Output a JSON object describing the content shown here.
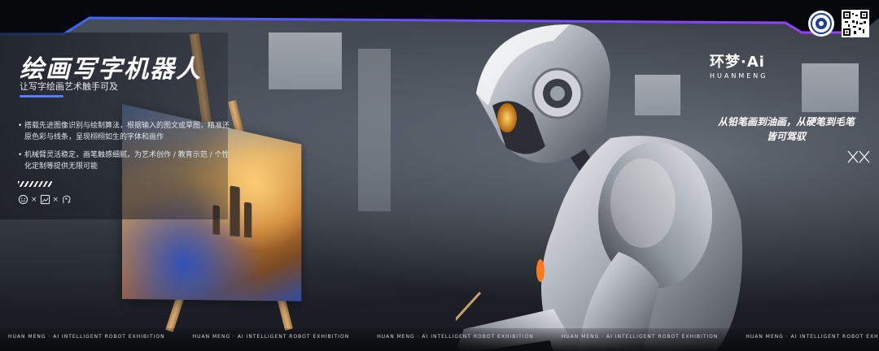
{
  "title": "绘画写字机器人",
  "subtitle": "让写字绘画艺术触手可及",
  "bullets": [
    "搭载先进图像识别与绘制算法，根据输入的图文或草图，精准还原色彩与线条，呈现栩栩如生的字体和画作",
    "机械臂灵活稳定，画笔触感细腻，为艺术创作 / 教育示范 / 个性化定制等提供无限可能"
  ],
  "icon_row": {
    "icons": [
      "smile-icon",
      "frame-icon",
      "idea-head-icon"
    ],
    "separator": "×"
  },
  "brand": {
    "name": "环梦·Ai",
    "pinyin": "HUANMENG"
  },
  "slogan": {
    "line1": "从铅笔画到油画，从硬笔到毛笔",
    "line2": "皆可驾驭"
  },
  "ticker_text": "HUAN MENG · AI INTELLIGENT ROBOT EXHIBITION",
  "ticker_repeat": 6,
  "colors": {
    "accent": "#5a7bff",
    "frame_gradient_start": "#2f6bff",
    "frame_gradient_end": "#9b3dff"
  }
}
